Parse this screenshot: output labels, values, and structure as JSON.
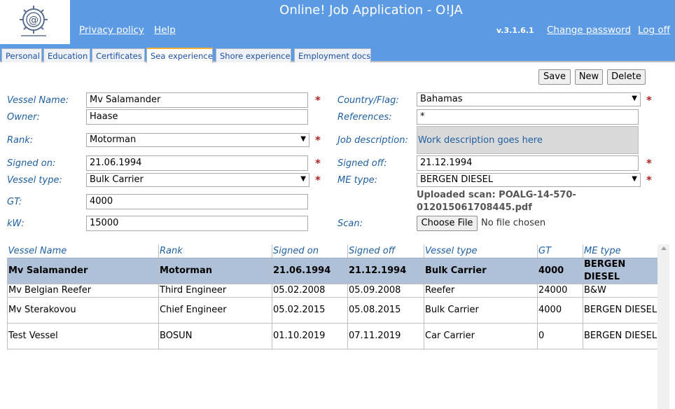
{
  "header": {
    "title": "Online! Job Application - O!JA",
    "privacy_label": "Privacy policy",
    "help_label": "Help",
    "version": "v.3.1.6.1",
    "change_password_label": "Change password",
    "logoff_label": "Log off"
  },
  "tabs": [
    {
      "label": "Personal"
    },
    {
      "label": "Education"
    },
    {
      "label": "Certificates"
    },
    {
      "label": "Sea experience",
      "active": true
    },
    {
      "label": "Shore experience"
    },
    {
      "label": "Employment docs"
    }
  ],
  "buttons": {
    "save": "Save",
    "new": "New",
    "delete": "Delete"
  },
  "form": {
    "vessel_name": {
      "label": "Vessel Name:",
      "value": "Mv Salamander"
    },
    "owner": {
      "label": "Owner:",
      "value": "Haase"
    },
    "rank": {
      "label": "Rank:",
      "value": "Motorman"
    },
    "signed_on": {
      "label": "Signed on:",
      "value": "21.06.1994"
    },
    "vessel_type": {
      "label": "Vessel type:",
      "value": "Bulk Carrier"
    },
    "gt": {
      "label": "GT:",
      "value": "4000"
    },
    "kw": {
      "label": "kW:",
      "value": "15000"
    },
    "country_flag": {
      "label": "Country/Flag:",
      "value": "Bahamas"
    },
    "references": {
      "label": "References:",
      "value": "*"
    },
    "job_description": {
      "label": "Job description:",
      "value": "Work description goes here"
    },
    "signed_off": {
      "label": "Signed off:",
      "value": "21.12.1994"
    },
    "me_type": {
      "label": "ME type:",
      "value": "BERGEN DIESEL"
    },
    "uploaded_scan": "Uploaded scan: POALG-14-570-012015061708445.pdf",
    "scan": {
      "label": "Scan:",
      "button": "Choose File",
      "status": "No file chosen"
    },
    "required_mark": "*"
  },
  "grid": {
    "columns": [
      "Vessel Name",
      "Rank",
      "Signed on",
      "Signed off",
      "Vessel type",
      "GT",
      "ME type"
    ],
    "rows": [
      [
        "Mv Salamander",
        "Motorman",
        "21.06.1994",
        "21.12.1994",
        "Bulk Carrier",
        "4000",
        "BERGEN DIESEL"
      ],
      [
        "Mv Belgian Reefer",
        "Third Engineer",
        "05.02.2008",
        "05.09.2008",
        "Reefer",
        "24000",
        "B&W"
      ],
      [
        "Mv Sterakovou",
        "Chief Engineer",
        "05.02.2015",
        "05.08.2015",
        "Bulk Carrier",
        "4000",
        "BERGEN DIESEL"
      ],
      [
        "Test Vessel",
        "BOSUN",
        "01.10.2019",
        "07.11.2019",
        "Car Carrier",
        "0",
        "BERGEN DIESEL"
      ]
    ]
  }
}
